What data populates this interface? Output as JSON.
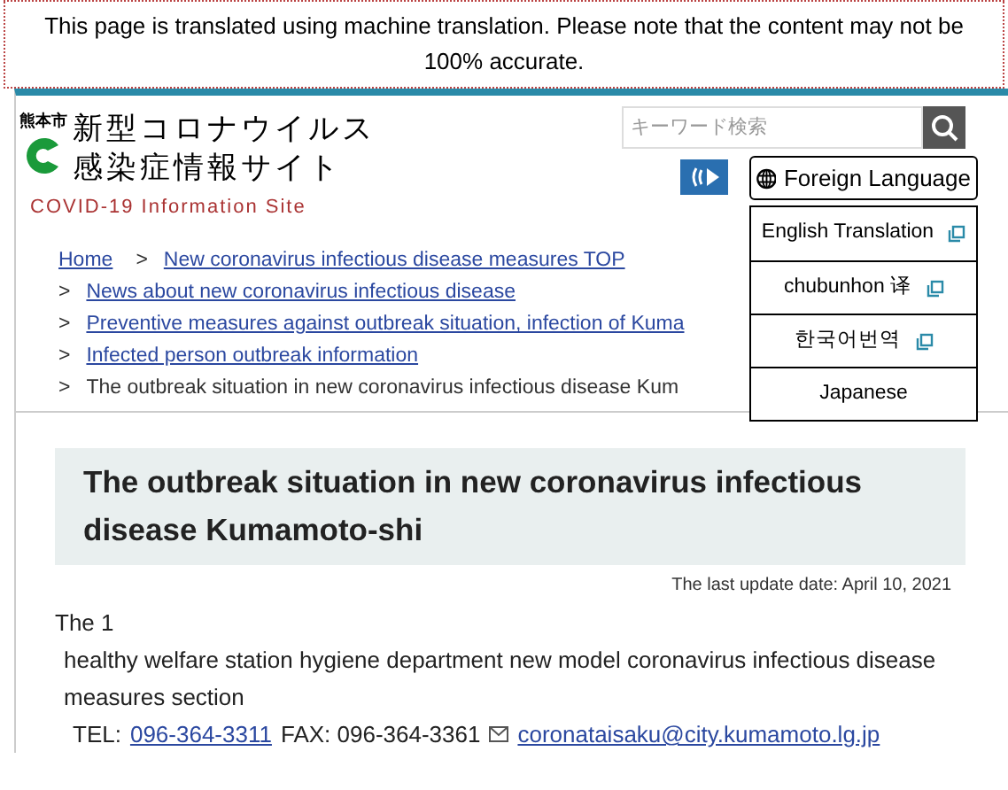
{
  "notice": "This page is translated using machine translation. Please note that the content may not be 100% accurate.",
  "header": {
    "city": "熊本市",
    "site_title_lines": [
      "新型コロナウイルス",
      "感染症情報サイト"
    ],
    "subtitle": "COVID-19 Information Site",
    "search": {
      "placeholder": "キーワード検索"
    }
  },
  "language_menu": {
    "label": "Foreign Language",
    "items": [
      {
        "label": "English Translation",
        "external": true
      },
      {
        "label": "chubunhon 译",
        "external": true
      },
      {
        "label": "한국어번역",
        "external": true
      },
      {
        "label": "Japanese",
        "external": false
      }
    ]
  },
  "breadcrumb": [
    {
      "label": "Home",
      "link": true,
      "separator": false
    },
    {
      "label": "New coronavirus infectious disease measures TOP",
      "link": true,
      "separator": true
    },
    {
      "label": "News about new coronavirus infectious disease",
      "link": true,
      "separator": true
    },
    {
      "label": "Preventive measures against outbreak situation, infection of Kuma",
      "link": true,
      "separator": true
    },
    {
      "label": "Infected person outbreak information",
      "link": true,
      "separator": true
    },
    {
      "label": "The outbreak situation in new coronavirus infectious disease Kum",
      "link": false,
      "separator": true
    }
  ],
  "separator": ">",
  "page_title": "The outbreak situation in new coronavirus infectious disease Kumamoto-shi",
  "last_update": "The last update date: April 10, 2021",
  "contact": {
    "line_1": "The 1",
    "department": "healthy welfare station hygiene department new model coronavirus infectious disease measures section",
    "tel_label": "TEL:",
    "tel": "096-364-3311",
    "fax": "FAX: 096-364-3361",
    "email": "coronataisaku@city.kumamoto.lg.jp"
  }
}
